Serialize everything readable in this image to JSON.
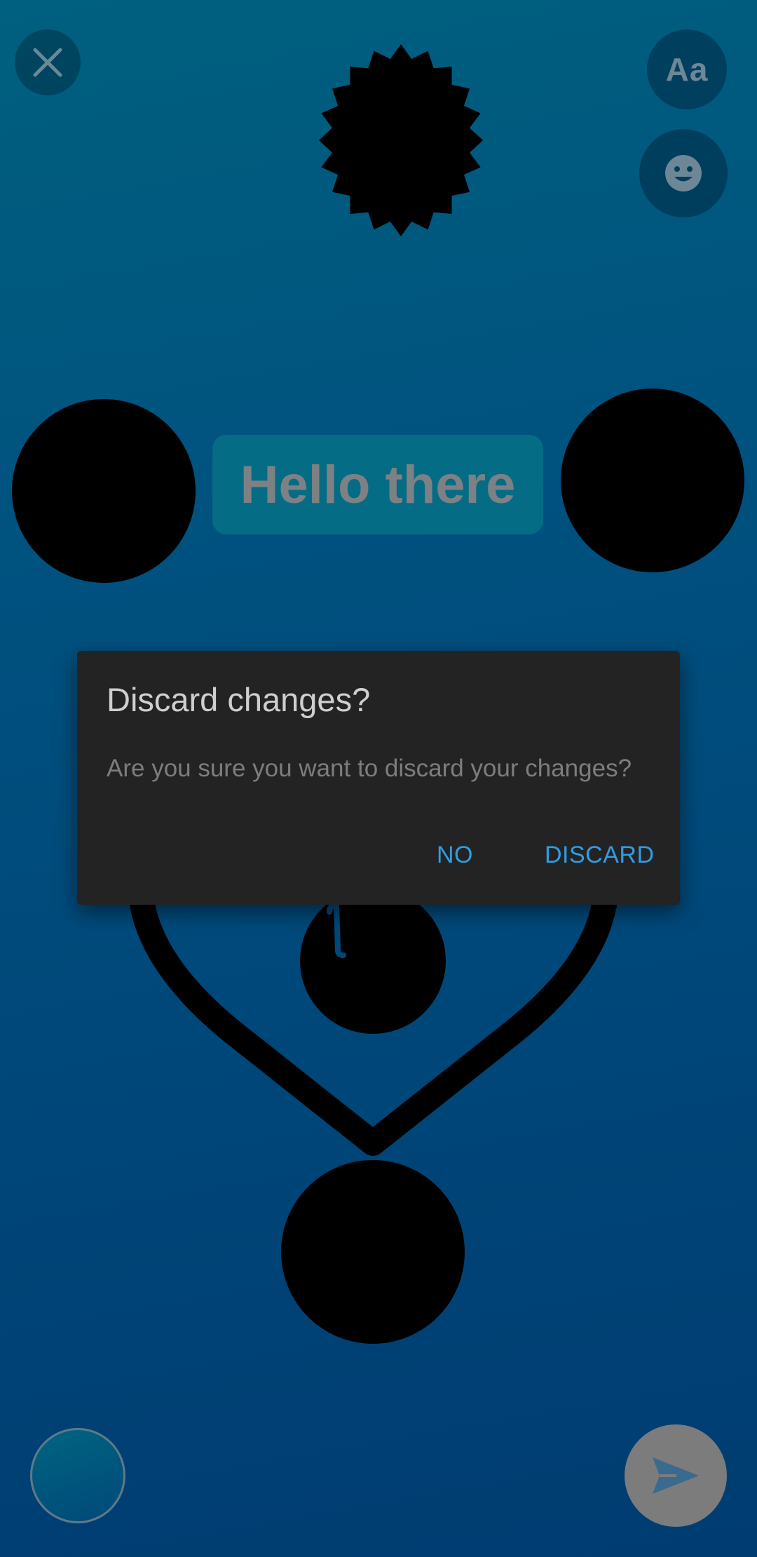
{
  "top_bar": {
    "close_icon": "close-icon",
    "text_tool_label": "Aa",
    "emoji_icon": "emoji-icon"
  },
  "canvas": {
    "text_sticker": "Hello there",
    "stickers": [
      "starburst-sticker",
      "circle-sticker-left",
      "circle-sticker-right",
      "heart-outline-sticker",
      "hook-circle-sticker",
      "circle-sticker-bottom"
    ]
  },
  "dialog": {
    "title": "Discard changes?",
    "message": "Are you sure you want to discard your changes?",
    "negative_label": "NO",
    "positive_label": "DISCARD"
  },
  "bottom_bar": {
    "color_picker_icon": "color-picker-icon",
    "send_icon": "send-icon"
  },
  "colors": {
    "accent": "#2f9de6",
    "dialog_bg": "#232323",
    "background_top": "#00607f",
    "background_bottom": "#003c71"
  }
}
